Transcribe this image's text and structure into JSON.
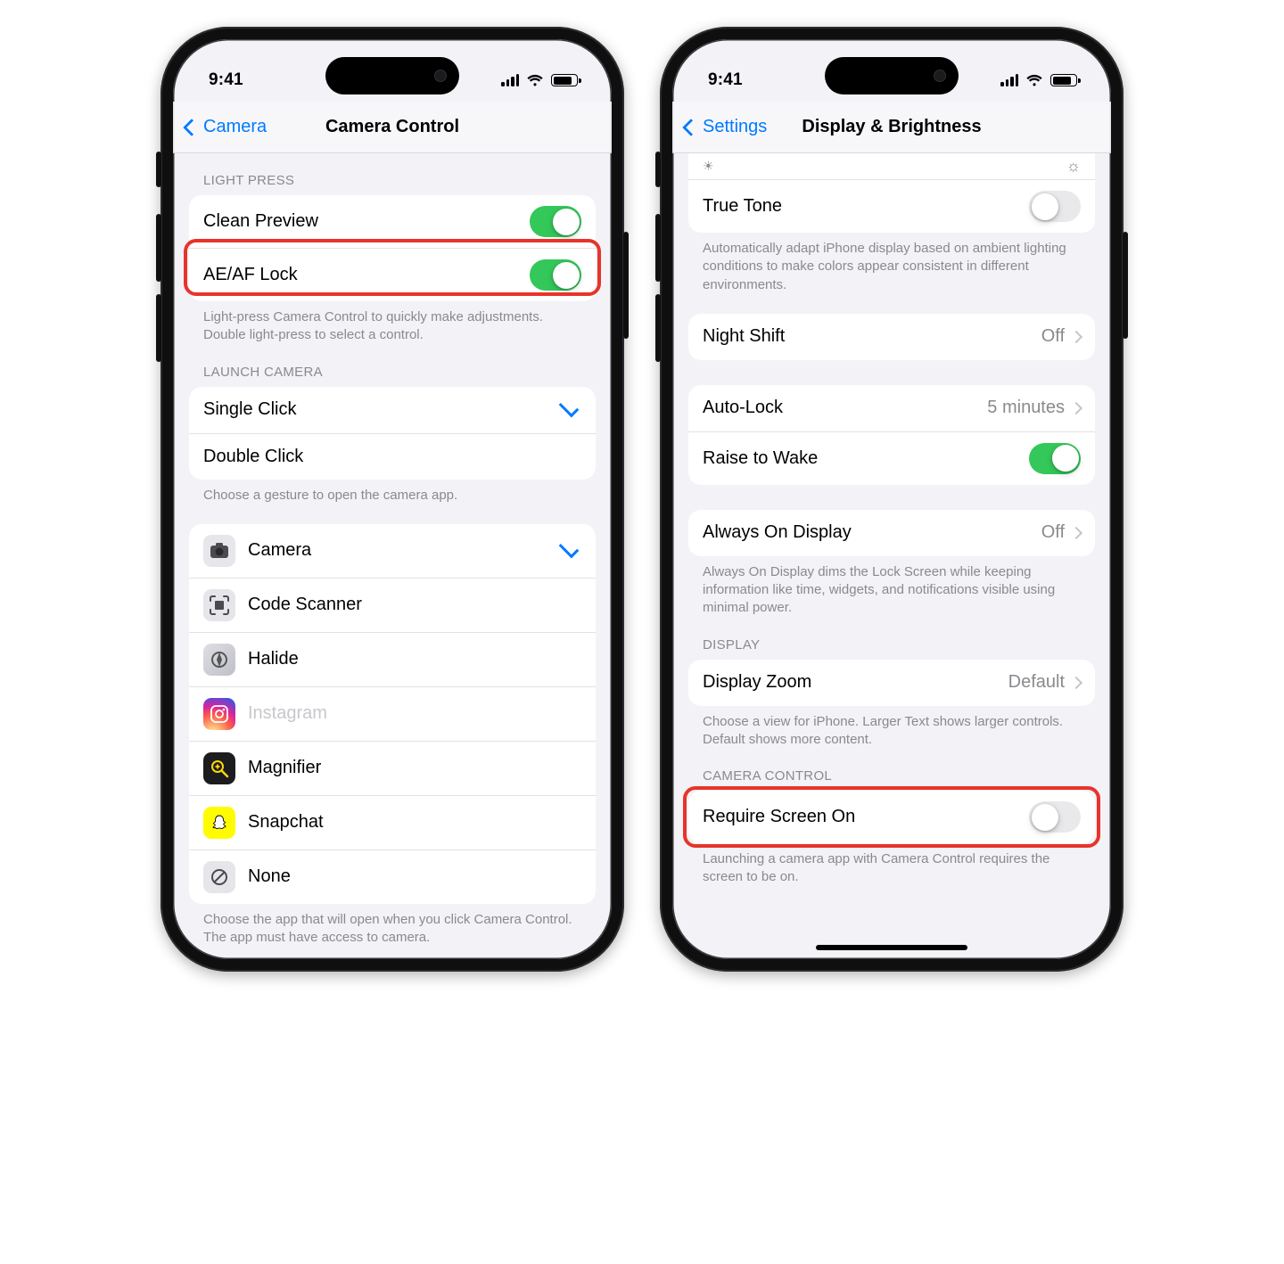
{
  "status": {
    "time": "9:41"
  },
  "left": {
    "back": "Camera",
    "title": "Camera Control",
    "sections": {
      "light_press": {
        "header": "LIGHT PRESS",
        "rows": [
          {
            "label": "Clean Preview",
            "on": true
          },
          {
            "label": "AE/AF Lock",
            "on": true,
            "highlighted": true
          }
        ],
        "footer": "Light-press Camera Control to quickly make adjustments. Double light-press to select a control."
      },
      "launch_camera": {
        "header": "LAUNCH CAMERA",
        "rows": [
          {
            "label": "Single Click",
            "checked": true
          },
          {
            "label": "Double Click"
          }
        ],
        "footer": "Choose a gesture to open the camera app."
      },
      "apps": {
        "rows": [
          {
            "label": "Camera",
            "checked": true,
            "icon": "camera"
          },
          {
            "label": "Code Scanner",
            "icon": "qr"
          },
          {
            "label": "Halide",
            "icon": "halide"
          },
          {
            "label": "Instagram",
            "icon": "instagram",
            "disabled": true
          },
          {
            "label": "Magnifier",
            "icon": "magnifier"
          },
          {
            "label": "Snapchat",
            "icon": "snapchat"
          },
          {
            "label": "None",
            "icon": "none"
          }
        ],
        "footer": "Choose the app that will open when you click Camera Control. The app must have access to camera."
      }
    }
  },
  "right": {
    "back": "Settings",
    "title": "Display & Brightness",
    "sections": {
      "truetone": {
        "rows": [
          {
            "label": "True Tone",
            "on": false
          }
        ],
        "footer": "Automatically adapt iPhone display based on ambient lighting conditions to make colors appear consistent in different environments."
      },
      "night_shift": {
        "rows": [
          {
            "label": "Night Shift",
            "value": "Off",
            "nav": true
          }
        ]
      },
      "autolock": {
        "rows": [
          {
            "label": "Auto-Lock",
            "value": "5 minutes",
            "nav": true
          },
          {
            "label": "Raise to Wake",
            "on": true
          }
        ]
      },
      "aod": {
        "rows": [
          {
            "label": "Always On Display",
            "value": "Off",
            "nav": true
          }
        ],
        "footer": "Always On Display dims the Lock Screen while keeping information like time, widgets, and notifications visible using minimal power."
      },
      "display": {
        "header": "DISPLAY",
        "rows": [
          {
            "label": "Display Zoom",
            "value": "Default",
            "nav": true
          }
        ],
        "footer": "Choose a view for iPhone. Larger Text shows larger controls. Default shows more content."
      },
      "camctrl": {
        "header": "CAMERA CONTROL",
        "rows": [
          {
            "label": "Require Screen On",
            "on": false,
            "highlighted": true
          }
        ],
        "footer": "Launching a camera app with Camera Control requires the screen to be on."
      }
    }
  }
}
